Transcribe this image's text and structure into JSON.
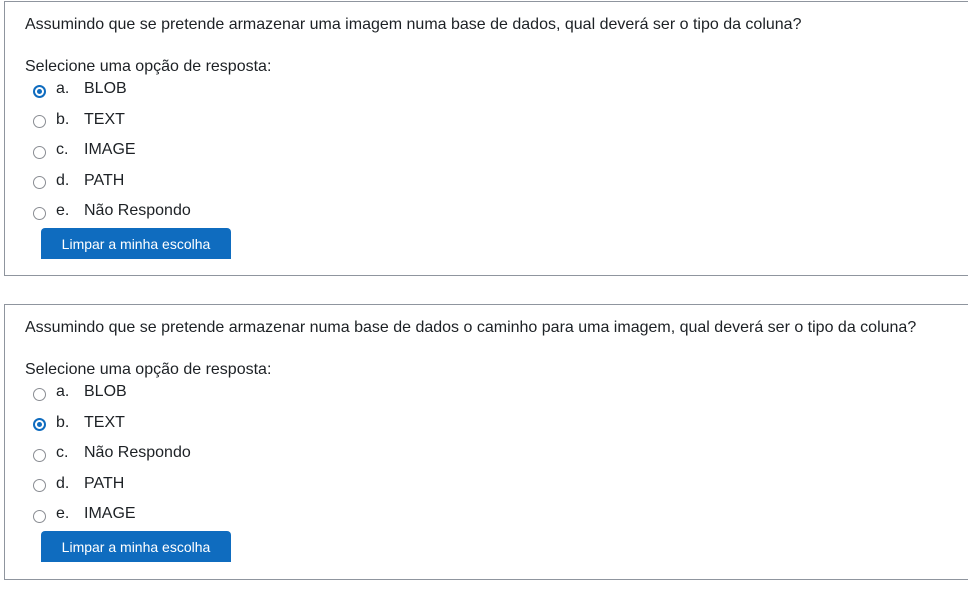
{
  "questions": [
    {
      "text": "Assumindo que se pretende armazenar uma imagem numa base de dados, qual deverá ser o tipo da coluna?",
      "prompt": "Selecione uma opção de resposta:",
      "options": [
        {
          "letter": "a.",
          "label": "BLOB",
          "checked": true
        },
        {
          "letter": "b.",
          "label": "TEXT",
          "checked": false
        },
        {
          "letter": "c.",
          "label": "IMAGE",
          "checked": false
        },
        {
          "letter": "d.",
          "label": "PATH",
          "checked": false
        },
        {
          "letter": "e.",
          "label": "Não Respondo",
          "checked": false
        }
      ],
      "clear_label": "Limpar a minha escolha"
    },
    {
      "text": "Assumindo que se pretende armazenar numa base de dados o caminho para uma imagem, qual deverá ser o tipo da coluna?",
      "prompt": "Selecione uma opção de resposta:",
      "options": [
        {
          "letter": "a.",
          "label": "BLOB",
          "checked": false
        },
        {
          "letter": "b.",
          "label": "TEXT",
          "checked": true
        },
        {
          "letter": "c.",
          "label": "Não Respondo",
          "checked": false
        },
        {
          "letter": "d.",
          "label": "PATH",
          "checked": false
        },
        {
          "letter": "e.",
          "label": "IMAGE",
          "checked": false
        }
      ],
      "clear_label": "Limpar a minha escolha"
    }
  ],
  "accent": "#0f6cbf"
}
